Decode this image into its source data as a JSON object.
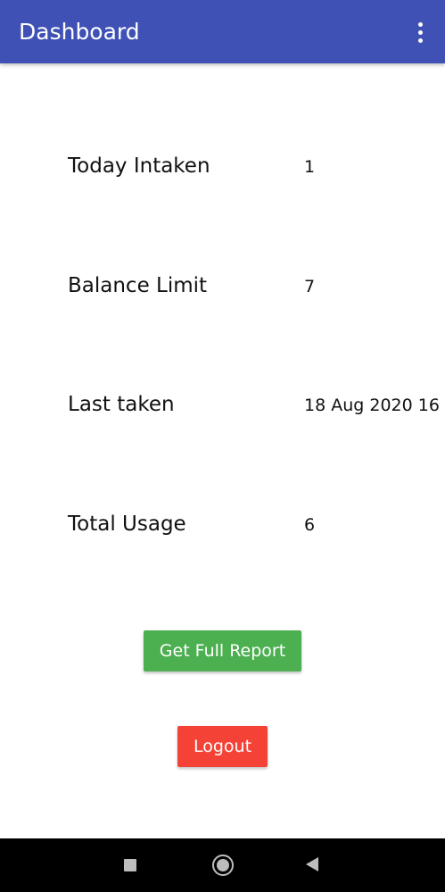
{
  "appbar": {
    "title": "Dashboard",
    "menu_icon": "more-vert-icon",
    "background": "#3f51b5"
  },
  "stats": [
    {
      "label": "Today Intaken",
      "value": "1"
    },
    {
      "label": "Balance Limit",
      "value": "7"
    },
    {
      "label": "Last taken",
      "value": "18 Aug 2020  16"
    },
    {
      "label": "Total Usage",
      "value": "6"
    }
  ],
  "buttons": {
    "report_label": "Get Full Report",
    "report_color": "#4caf50",
    "logout_label": "Logout",
    "logout_color": "#f44336"
  },
  "navbar": {
    "recent_icon": "recent-apps-icon",
    "home_icon": "home-icon",
    "back_icon": "back-icon"
  }
}
